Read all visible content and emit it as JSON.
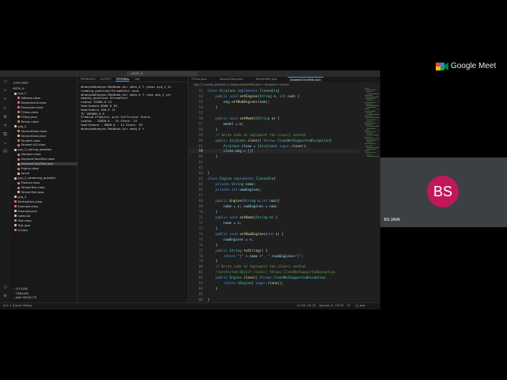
{
  "window": {
    "search": "week_6"
  },
  "sidebar": {
    "header": "EXPLORER",
    "root": "WEEK_6",
    "items": [
      {
        "label": "pyq_1",
        "indent": 1,
        "color": "#c5c5c5"
      },
      {
        "label": "Address.class",
        "indent": 2,
        "color": "#e06c75"
      },
      {
        "label": "Department.class",
        "indent": 2,
        "color": "#e06c75"
      },
      {
        "label": "Employee.class",
        "indent": 2,
        "color": "#e06c75"
      },
      {
        "label": "FClass.class",
        "indent": 2,
        "color": "#e06c75"
      },
      {
        "label": "FClass.java",
        "indent": 2,
        "color": "#e5c07b"
      },
      {
        "label": "Person.class",
        "indent": 2,
        "color": "#e06c75"
      },
      {
        "label": "pyq_2",
        "indent": 1,
        "color": "#c5c5c5"
      },
      {
        "label": "SecondClass.class",
        "indent": 2,
        "color": "#e06c75"
      },
      {
        "label": "SecondClass.java",
        "indent": 2,
        "color": "#e5c07b"
      },
      {
        "label": "Student.class",
        "indent": 2,
        "color": "#e06c75"
      },
      {
        "label": "Student.UG.class",
        "indent": 2,
        "color": "#e06c75"
      },
      {
        "label": "pyq_3_cloning_question",
        "indent": 1,
        "color": "#c5c5c5"
      },
      {
        "label": "Airplane.class",
        "indent": 2,
        "color": "#e06c75"
      },
      {
        "label": "AirplaneCloneTest.class",
        "indent": 2,
        "color": "#e06c75"
      },
      {
        "label": "AirplaneCloneTest.java",
        "indent": 2,
        "color": "#e5c07b",
        "selected": true
      },
      {
        "label": "Engine.class",
        "indent": 2,
        "color": "#e06c75"
      },
      {
        "label": "ap.txt",
        "indent": 2,
        "color": "#c5c5c5"
      },
      {
        "label": "pyq_2_streaming_question",
        "indent": 1,
        "color": "#c5c5c5"
      },
      {
        "label": "Product.class",
        "indent": 2,
        "color": "#e06c75"
      },
      {
        "label": "StreamTest.class",
        "indent": 2,
        "color": "#e06c75"
      },
      {
        "label": "StreamTest.java",
        "indent": 2,
        "color": "#e5c07b"
      },
      {
        "label": "pyq_3",
        "indent": 1,
        "color": "#c5c5c5"
      },
      {
        "label": "Destination.class",
        "indent": 1,
        "color": "#e06c75"
      },
      {
        "label": "Example.class",
        "indent": 1,
        "color": "#e06c75"
      },
      {
        "label": "Example.java",
        "indent": 1,
        "color": "#e5c07b"
      },
      {
        "label": "notes.txt",
        "indent": 1,
        "color": "#c5c5c5"
      },
      {
        "label": "Test.class",
        "indent": 1,
        "color": "#e06c75"
      },
      {
        "label": "Test.java",
        "indent": 1,
        "color": "#e5c07b"
      },
      {
        "label": "X.class",
        "indent": 1,
        "color": "#e06c75"
      }
    ],
    "sections": [
      "OUTLINE",
      "TIMELINE",
      "JAVA PROJECTS"
    ]
  },
  "terminal": {
    "tabs": [
      "PROBLEMS",
      "OUTPUT",
      "TERMINAL",
      "zsh"
    ],
    "lines": [
      "dhanyakdhanyas-MacBook-Air week_6 % javac pyq_2_st",
      "reaming_question/StreamTest.java",
      "dhanyakdhanyas-MacBook-Air week_6 % java pyq_2_str",
      "eaming_question.StreamTest",
      "Laptop 32000.0 15",
      "Smartphone 8000.0 30",
      "Smartwatch 100.0 12",
      "TV 100000.0 8",
      "Premium Products with Sufficient Stock:",
      "Laptop - 32000.0 - In Stock: 15",
      "Smartphone - 8000.0 - In Stock: 30",
      "dhanyakdhanyas-MacBook-Air week_6 % "
    ]
  },
  "editor": {
    "tabs": [
      "FClass.java",
      "SecondClass.java",
      "StreamTest.java",
      "AirplaneCloneTest.java"
    ],
    "active_tab": "AirplaneCloneTest.java",
    "breadcrumb": "pyq_3_cloning_question > AirplaneCloneTest.java > Airplane > clone()",
    "current_line": "59",
    "lines": [
      {
        "n": "51",
        "h": "<span class='kw'>class</span> <span class='ty'>Airplane</span> <span class='kw'>implements</span> <span class='ty'>Cloneable</span><span class='tx'>{</span>"
      },
      {
        "n": "52",
        "h": "    <span class='kw'>public</span> <span class='kw'>void</span> <span class='fn'>setEngine</span><span class='tx'>(</span><span class='ty'>String</span> <span class='pm'>e</span><span class='tx'>, </span><span class='kw'>int</span> <span class='pm'>num</span><span class='tx'>) {</span>"
      },
      {
        "n": "53",
        "h": "        <span class='pm'>eng</span><span class='tx'>.</span><span class='fn'>setNumEngines</span><span class='tx'>(</span><span class='pm'>num</span><span class='tx'>);</span>"
      },
      {
        "n": "54",
        "h": "    <span class='tx'>}</span>"
      },
      {
        "n": "55",
        "h": ""
      },
      {
        "n": "56",
        "h": "    <span class='kw'>public</span> <span class='kw'>void</span> <span class='fn'>setModel</span><span class='tx'>(</span><span class='ty'>String</span> <span class='pm'>m</span><span class='tx'>) {</span>"
      },
      {
        "n": "57",
        "h": "        <span class='pm'>model</span> <span class='tx'>= </span><span class='pm'>m</span><span class='tx'>;</span>"
      },
      {
        "n": "58",
        "h": "    <span class='tx'>}</span>"
      },
      {
        "n": "59",
        "h": "    <span class='cm'>// Write code to implement the clone() method</span>"
      },
      {
        "n": "60",
        "h": "    <span class='kw'>public</span> <span class='ty'>Airplane</span> <span class='fn'>clone</span><span class='tx'>() </span><span class='kw'>throws</span> <span class='ty'>CloneNotSupportedException</span><span class='tx'>{</span>"
      },
      {
        "n": "61",
        "h": "        <span class='ty'>Airplane</span> <span class='pm'>clone</span> <span class='tx'>= (</span><span class='ty'>Airplane</span><span class='tx'>) </span><span class='kw'>super</span><span class='tx'>.</span><span class='fn'>clone</span><span class='tx'>();</span>"
      },
      {
        "n": "59",
        "h": "        <span class='pm'>clone</span><span class='tx'>.</span><span class='pm'>eng</span> <span class='tx'>= [|]</span>",
        "cur": true
      },
      {
        "n": "60",
        "h": "    <span class='tx'>}</span>"
      },
      {
        "n": "61",
        "h": ""
      },
      {
        "n": "62",
        "h": ""
      },
      {
        "n": "63",
        "h": "<span class='tx'>}</span>"
      },
      {
        "n": "64",
        "h": "<span class='kw'>class</span> <span class='ty'>Engine</span> <span class='kw'>implements</span> <span class='ty'>Cloneable</span><span class='tx'>{</span>"
      },
      {
        "n": "65",
        "h": "    <span class='kw'>private</span> <span class='ty'>String</span> <span class='pm'>name</span><span class='tx'>;</span>"
      },
      {
        "n": "66",
        "h": "    <span class='kw'>private</span> <span class='kw'>int</span> <span class='pm'>numEngines</span><span class='tx'>;</span>"
      },
      {
        "n": "67",
        "h": ""
      },
      {
        "n": "68",
        "h": "    <span class='kw'>public</span> <span class='fn'>Engine</span><span class='tx'>(</span><span class='ty'>String</span> <span class='pm'>n</span><span class='tx'>,</span><span class='kw'>int</span> <span class='pm'>num</span><span class='tx'>){</span>"
      },
      {
        "n": "69",
        "h": "        <span class='pm'>name</span> <span class='tx'>= </span><span class='pm'>n</span><span class='tx'>; </span><span class='pm'>numEngines</span> <span class='tx'>= </span><span class='pm'>num</span><span class='tx'>;</span>"
      },
      {
        "n": "70",
        "h": "    <span class='tx'>}</span>"
      },
      {
        "n": "71",
        "h": "    <span class='kw'>public</span> <span class='kw'>void</span> <span class='fn'>setName</span><span class='tx'>(</span><span class='ty'>String</span> <span class='pm'>n</span><span class='tx'>) {</span>"
      },
      {
        "n": "72",
        "h": "        <span class='pm'>name</span> <span class='tx'>= </span><span class='pm'>n</span><span class='tx'>;</span>"
      },
      {
        "n": "73",
        "h": "    <span class='tx'>}</span>"
      },
      {
        "n": "74",
        "h": "    <span class='kw'>public</span> <span class='kw'>void</span> <span class='fn'>setNumEngines</span><span class='tx'>(</span><span class='kw'>int</span> <span class='pm'>n</span><span class='tx'>) {</span>"
      },
      {
        "n": "75",
        "h": "        <span class='pm'>numEngines</span> <span class='tx'>= </span><span class='pm'>n</span><span class='tx'>;</span>"
      },
      {
        "n": "76",
        "h": "    <span class='tx'>}</span>"
      },
      {
        "n": "77",
        "h": "    <span class='kw'>public</span> <span class='ty'>String</span> <span class='fn'>toString</span><span class='tx'>() {</span>"
      },
      {
        "n": "78",
        "h": "        <span class='kw'>return</span> <span class='str'>\"[\"</span> <span class='tx'>+ </span><span class='pm'>name</span> <span class='tx'>+</span><span class='str'>\", \"</span> <span class='tx'>+</span><span class='pm'>numEngines</span><span class='tx'>+</span><span class='str'>\"]\"</span><span class='tx'>;</span>"
      },
      {
        "n": "79",
        "h": "    <span class='tx'>}</span>"
      },
      {
        "n": "80",
        "h": "    <span class='cm'>// Write code to implement the clone() method</span>"
      },
      {
        "n": "81",
        "h": "    <span class='cm'>//protected Object clone() throws CloneNotSupportedException</span>"
      },
      {
        "n": "82",
        "h": "    <span class='kw'>public</span> <span class='ty'>Engine</span> <span class='fn'>clone</span><span class='tx'>() </span><span class='kw'>throws</span> <span class='ty'>CloneNotSupportedException</span>"
      },
      {
        "n": "83",
        "h": "        <span class='kw'>return</span> <span class='tx'>(</span><span class='ty'>Engine</span><span class='tx'>) </span><span class='kw'>super</span><span class='tx'>.</span><span class='fn'>clone</span><span class='tx'>();</span>"
      },
      {
        "n": "84",
        "h": "    <span class='tx'>}</span>"
      },
      {
        "n": "85",
        "h": ""
      },
      {
        "n": "86",
        "h": "<span class='tx'>}</span>"
      }
    ]
  },
  "statusbar": {
    "left": "⊗ 0 ⚠ 0   Java: Ready",
    "position": "Ln 59, Col 20",
    "spaces": "Spaces: 4",
    "encoding": "UTF-8",
    "eol": "LF",
    "lang": "{} Java"
  },
  "meet": {
    "brand": "Google Meet",
    "avatar_initials": "BS",
    "participant_name": "BS JAVA",
    "avatar_color": "#c2185b"
  }
}
